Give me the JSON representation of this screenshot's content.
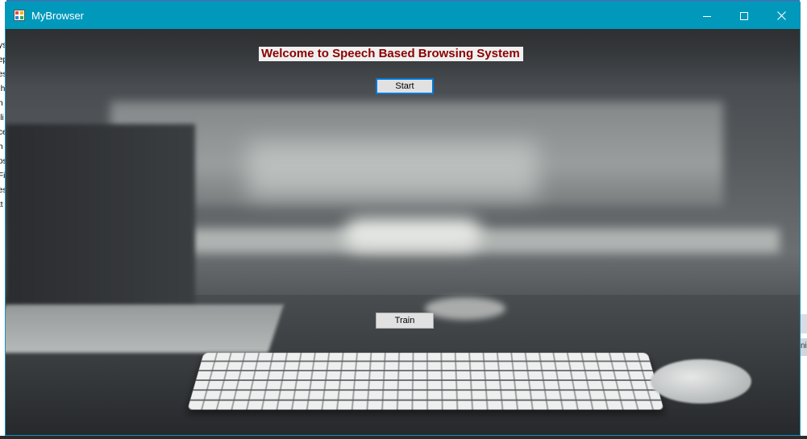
{
  "window": {
    "title": "MyBrowser",
    "titlebar_color": "#0099bc",
    "icons": [
      "app-icon",
      "minimize-icon",
      "maximize-icon",
      "close-icon"
    ]
  },
  "form": {
    "welcome_text": "Welcome to Speech Based Browsing System",
    "welcome_color": "#8b0000",
    "start_label": "Start",
    "train_label": "Train"
  },
  "background_desktop": {
    "left_fragments": [
      "ys",
      "",
      "ep",
      "es",
      ".h",
      "h",
      "lli",
      "ce",
      "h",
      "os",
      "Fi",
      "es",
      "tt"
    ],
    "right_fragment": "ni"
  }
}
